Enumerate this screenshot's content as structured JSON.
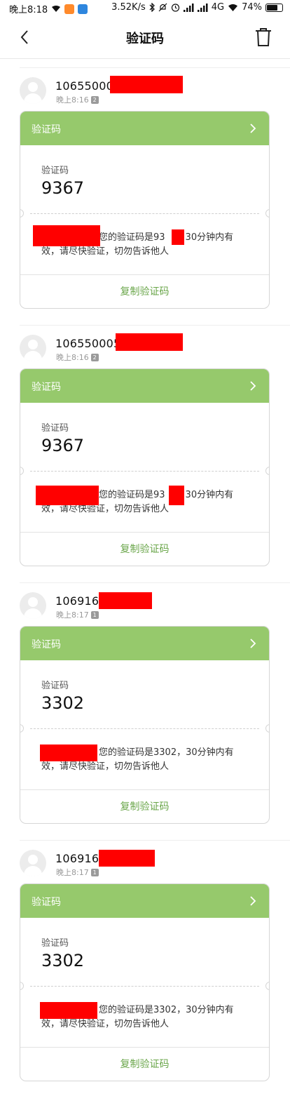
{
  "status_bar": {
    "time": "晚上8:18",
    "network_speed": "3.52K/s",
    "network_type": "4G",
    "battery": "74%",
    "battery_level": 0.74,
    "icons": [
      "wifi-icon",
      "app-icon-orange",
      "app-icon-blue",
      "bluetooth-icon",
      "mute-icon",
      "alarm-icon",
      "signal-icon",
      "signal-icon",
      "wifi-icon"
    ]
  },
  "header": {
    "title": "验证码",
    "back_icon": "chevron-left-icon",
    "delete_icon": "trash-icon"
  },
  "colors": {
    "card_header": "#96c96c",
    "copy_link": "#6aa64a",
    "redaction": "#ff0000"
  },
  "threads": [
    {
      "sender": "106550005",
      "time": "晚上8:16",
      "sim": "2",
      "card": {
        "title": "验证码",
        "code_label": "验证码",
        "code": "9367",
        "message_line1": "您的验证码是93",
        "message_line1_tail": "，30分钟内有",
        "message_line2": "效，请尽快验证，切勿告诉他人",
        "copy_label": "复制验证码"
      }
    },
    {
      "sender": "1065500053",
      "time": "晚上8:16",
      "sim": "2",
      "card": {
        "title": "验证码",
        "code_label": "验证码",
        "code": "9367",
        "message_line1": "您的验证码是93",
        "message_line1_tail": "，30分钟内有",
        "message_line2": "效，请尽快验证，切勿告诉他人",
        "copy_label": "复制验证码"
      }
    },
    {
      "sender": "1069166",
      "time": "晚上8:17",
      "sim": "1",
      "card": {
        "title": "验证码",
        "code_label": "验证码",
        "code": "3302",
        "message_line1": "您的验证码是3302",
        "message_line1_tail": "，30分钟内有",
        "message_line2": "效，请尽快验证，切勿告诉他人",
        "copy_label": "复制验证码"
      }
    },
    {
      "sender": "1069166",
      "time": "晚上8:17",
      "sim": "1",
      "card": {
        "title": "验证码",
        "code_label": "验证码",
        "code": "3302",
        "message_line1": "您的验证码是3302",
        "message_line1_tail": "，30分钟内有",
        "message_line2": "效，请尽快验证，切勿告诉他人",
        "copy_label": "复制验证码"
      }
    }
  ]
}
